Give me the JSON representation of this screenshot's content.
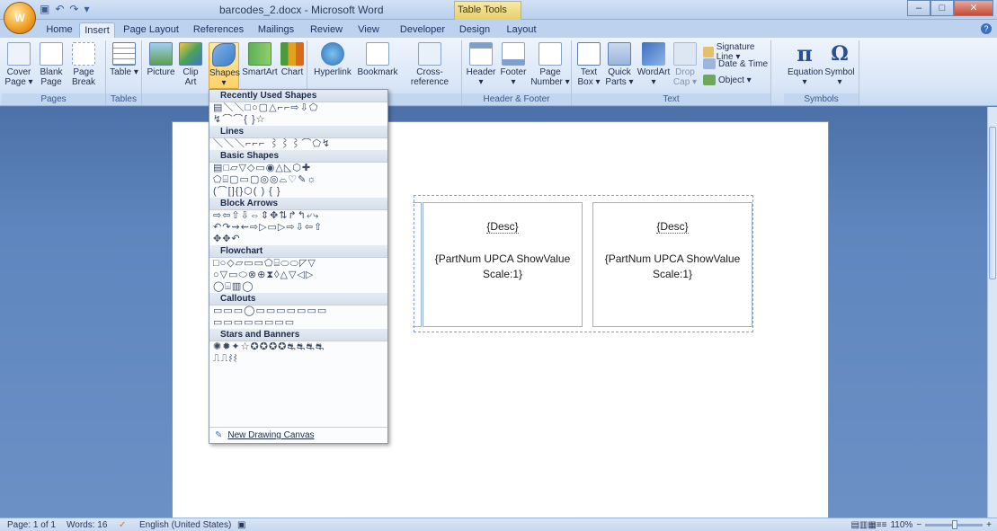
{
  "window": {
    "title": "barcodes_2.docx - Microsoft Word",
    "context_tab": "Table Tools",
    "office_button": "W",
    "min": "–",
    "max": "□",
    "close": "✕",
    "help": "?"
  },
  "tabs": [
    "Home",
    "Insert",
    "Page Layout",
    "References",
    "Mailings",
    "Review",
    "View",
    "Developer",
    "Design",
    "Layout"
  ],
  "ribbon": {
    "groups": {
      "pages": "Pages",
      "tables": "Tables",
      "illustrations": "Il",
      "links": "ks",
      "header_footer": "Header & Footer",
      "text": "Text",
      "symbols": "Symbols"
    },
    "buttons": {
      "cover_page": "Cover Page ▾",
      "blank_page": "Blank Page",
      "page_break": "Page Break",
      "table": "Table ▾",
      "picture": "Picture",
      "clip_art": "Clip Art",
      "shapes": "Shapes ▾",
      "smartart": "SmartArt",
      "chart": "Chart",
      "hyperlink": "Hyperlink",
      "bookmark": "Bookmark",
      "cross_reference": "Cross-reference",
      "header": "Header ▾",
      "footer": "Footer ▾",
      "page_number": "Page Number ▾",
      "text_box": "Text Box ▾",
      "quick_parts": "Quick Parts ▾",
      "wordart": "WordArt ▾",
      "drop_cap": "Drop Cap ▾",
      "signature_line": "Signature Line ▾",
      "date_time": "Date & Time",
      "object": "Object ▾",
      "equation": "Equation ▾",
      "symbol": "Symbol ▾"
    }
  },
  "document": {
    "cells": [
      {
        "desc": "{Desc}",
        "part_line1": "{PartNum UPCA ShowValue",
        "part_line2": "Scale:1}"
      },
      {
        "desc": "{Desc}",
        "part_line1": "{PartNum UPCA ShowValue",
        "part_line2": "Scale:1}"
      }
    ]
  },
  "shapes_menu": {
    "sections": [
      {
        "title": "Recently Used Shapes",
        "rows": [
          "▤＼＼□○▢△⌐⌐⇨⇩⬠",
          "↯⌒⌒{ }☆"
        ]
      },
      {
        "title": "Lines",
        "rows": [
          "＼＼＼⌐⌐⌐ ⌇⌇⌇⌒⬠↯"
        ]
      },
      {
        "title": "Basic Shapes",
        "rows": [
          "▤□▱▽◇▭◉△◺⬡✚",
          "⬠⌸▢▭▢◎◎⌓♡✎☼",
          "(⌒[]{}⬡( ) { }"
        ]
      },
      {
        "title": "Block Arrows",
        "rows": [
          "⇨⇦⇧⇩⇔⇕✥⇅↱↰⤶⤷",
          "↶↷⇝⇜⇨▷▭▷⇨⇩⇦⇧",
          "✥✥↶"
        ]
      },
      {
        "title": "Flowchart",
        "rows": [
          "□○◇▱▭▭⬠⌸⬭⬭◸▽",
          "○▽▭⬭⊗⊕⧗◊△▽◁▷",
          "◯⌸▥◯"
        ]
      },
      {
        "title": "Callouts",
        "rows": [
          "▭▭▭◯▭▭▭▭▭▭▭",
          "▭▭▭▭▭▭▭▭"
        ]
      },
      {
        "title": "Stars and Banners",
        "rows": [
          "✺✹✦☆✪✪✪✪⛐⛐⛐⛐",
          "⎍⎍⌇⌇"
        ]
      }
    ],
    "footer": "New Drawing Canvas"
  },
  "status": {
    "page": "Page: 1 of 1",
    "words": "Words: 16",
    "language": "English (United States)",
    "zoom": "110%",
    "zoom_minus": "−",
    "zoom_plus": "+"
  }
}
